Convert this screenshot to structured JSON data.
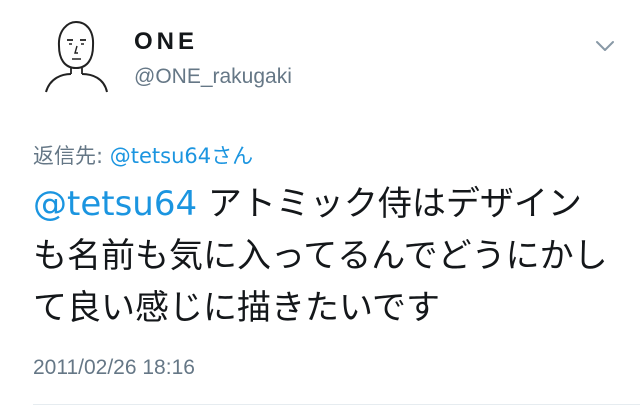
{
  "user": {
    "display_name": "ONE",
    "handle": "@ONE_rakugaki",
    "avatar_icon": "doodle-face-avatar-icon"
  },
  "menu": {
    "icon": "chevron-down-icon"
  },
  "reply": {
    "prefix": "返信先: ",
    "mention": "@tetsu64",
    "suffix": "さん"
  },
  "tweet": {
    "mention": "@tetsu64",
    "text": " アトミック侍はデザインも名前も気に入ってるんでどうにかして良い感じに描きたいです",
    "timestamp": "2011/02/26 18:16"
  },
  "colors": {
    "link": "#1b95e0",
    "secondary_text": "#657786",
    "primary_text": "#14171a",
    "divider": "#e6ecf0"
  }
}
